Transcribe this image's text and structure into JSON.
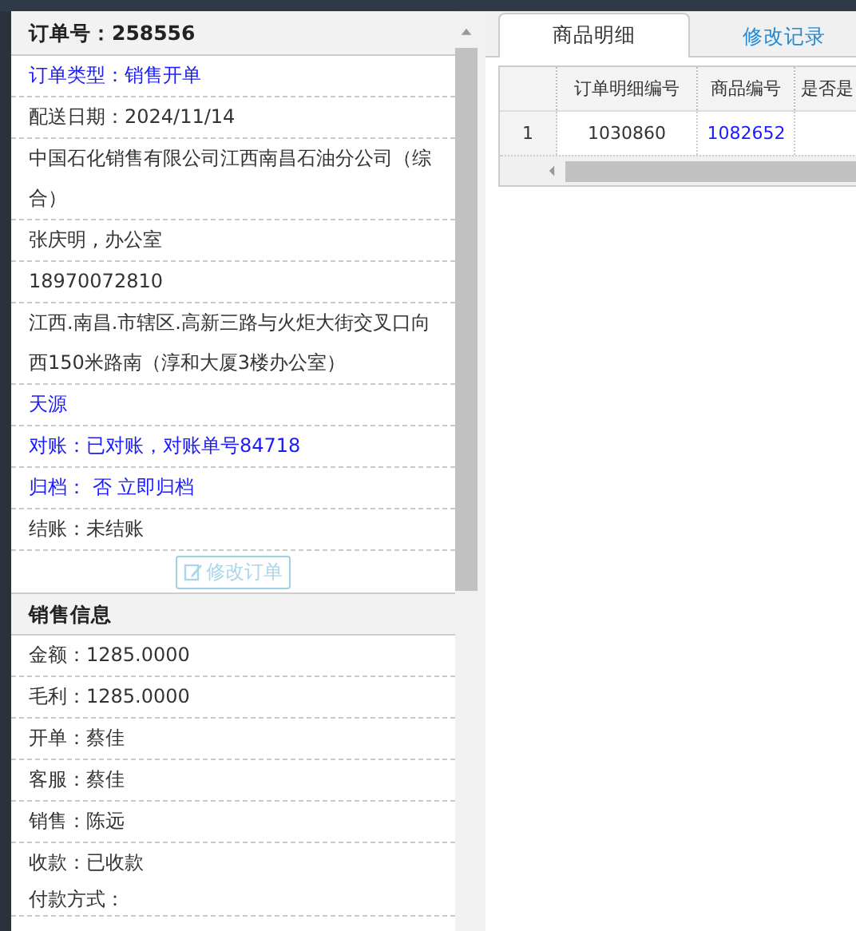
{
  "order": {
    "title": "订单号：258556",
    "rows": [
      {
        "text": "订单类型：销售开单",
        "kind": "link"
      },
      {
        "text": "配送日期：2024/11/14",
        "kind": "text"
      },
      {
        "text": "中国石化销售有限公司江西南昌石油分公司（综合）",
        "kind": "text"
      },
      {
        "text": "张庆明 , 办公室",
        "kind": "text"
      },
      {
        "text": "18970072810",
        "kind": "text"
      },
      {
        "text": "江西.南昌.市辖区.高新三路与火炬大街交叉口向西150米路南（淳和大厦3楼办公室）",
        "kind": "text"
      },
      {
        "text": "天源",
        "kind": "link"
      },
      {
        "text": "对账：已对账，对账单号84718",
        "kind": "link"
      },
      {
        "text": "归档： 否 立即归档",
        "kind": "link"
      },
      {
        "text": "结账：未结账",
        "kind": "text"
      }
    ],
    "button": {
      "label": "修改订单",
      "disabled": true
    }
  },
  "sales": {
    "title": "销售信息",
    "rows": [
      {
        "text": "金额：1285.0000"
      },
      {
        "text": "毛利：1285.0000"
      },
      {
        "text": "开单：蔡佳"
      },
      {
        "text": "客服：蔡佳"
      },
      {
        "text": "销售：陈远"
      },
      {
        "text": "收款：已收款"
      },
      {
        "text": "付款方式："
      }
    ]
  },
  "tabs": [
    {
      "label": "商品明细",
      "selected": true
    },
    {
      "label": "修改记录",
      "selected": false
    }
  ],
  "table": {
    "columns": [
      "订单明细编号",
      "商品编号",
      "是否是"
    ],
    "rows": [
      {
        "index": "1",
        "cells": [
          {
            "text": "1030860",
            "kind": "text"
          },
          {
            "text": "1082652",
            "kind": "link"
          }
        ]
      }
    ]
  }
}
